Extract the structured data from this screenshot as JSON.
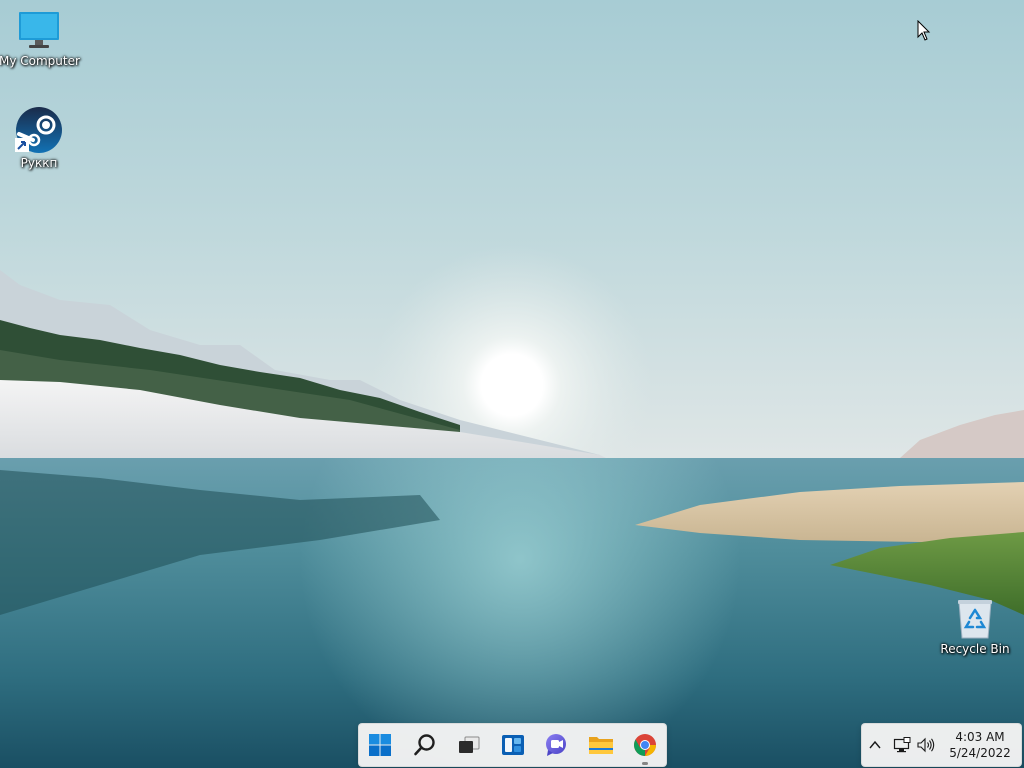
{
  "desktop": {
    "icons": [
      {
        "label": "My Computer",
        "icon": "monitor-icon"
      },
      {
        "label": "Руккп",
        "icon": "steam-icon"
      },
      {
        "label": "Recycle Bin",
        "icon": "recycle-bin-icon"
      }
    ],
    "wallpaper": "lake-landscape-sunrise"
  },
  "taskbar": {
    "apps": [
      {
        "name": "Start",
        "icon": "windows-start-icon"
      },
      {
        "name": "Search",
        "icon": "search-icon"
      },
      {
        "name": "Task View",
        "icon": "task-view-icon"
      },
      {
        "name": "Widgets",
        "icon": "widgets-icon"
      },
      {
        "name": "Chat",
        "icon": "teams-chat-icon"
      },
      {
        "name": "File Explorer",
        "icon": "folder-icon"
      },
      {
        "name": "Google Chrome",
        "icon": "chrome-icon",
        "running": true
      }
    ]
  },
  "tray": {
    "time": "4:03 AM",
    "date": "5/24/2022",
    "icons": [
      "chevron-up-icon",
      "network-icon",
      "speaker-icon"
    ]
  },
  "colors": {
    "taskbar_bg": "#f3f3f3",
    "accent": "#0078d4"
  }
}
